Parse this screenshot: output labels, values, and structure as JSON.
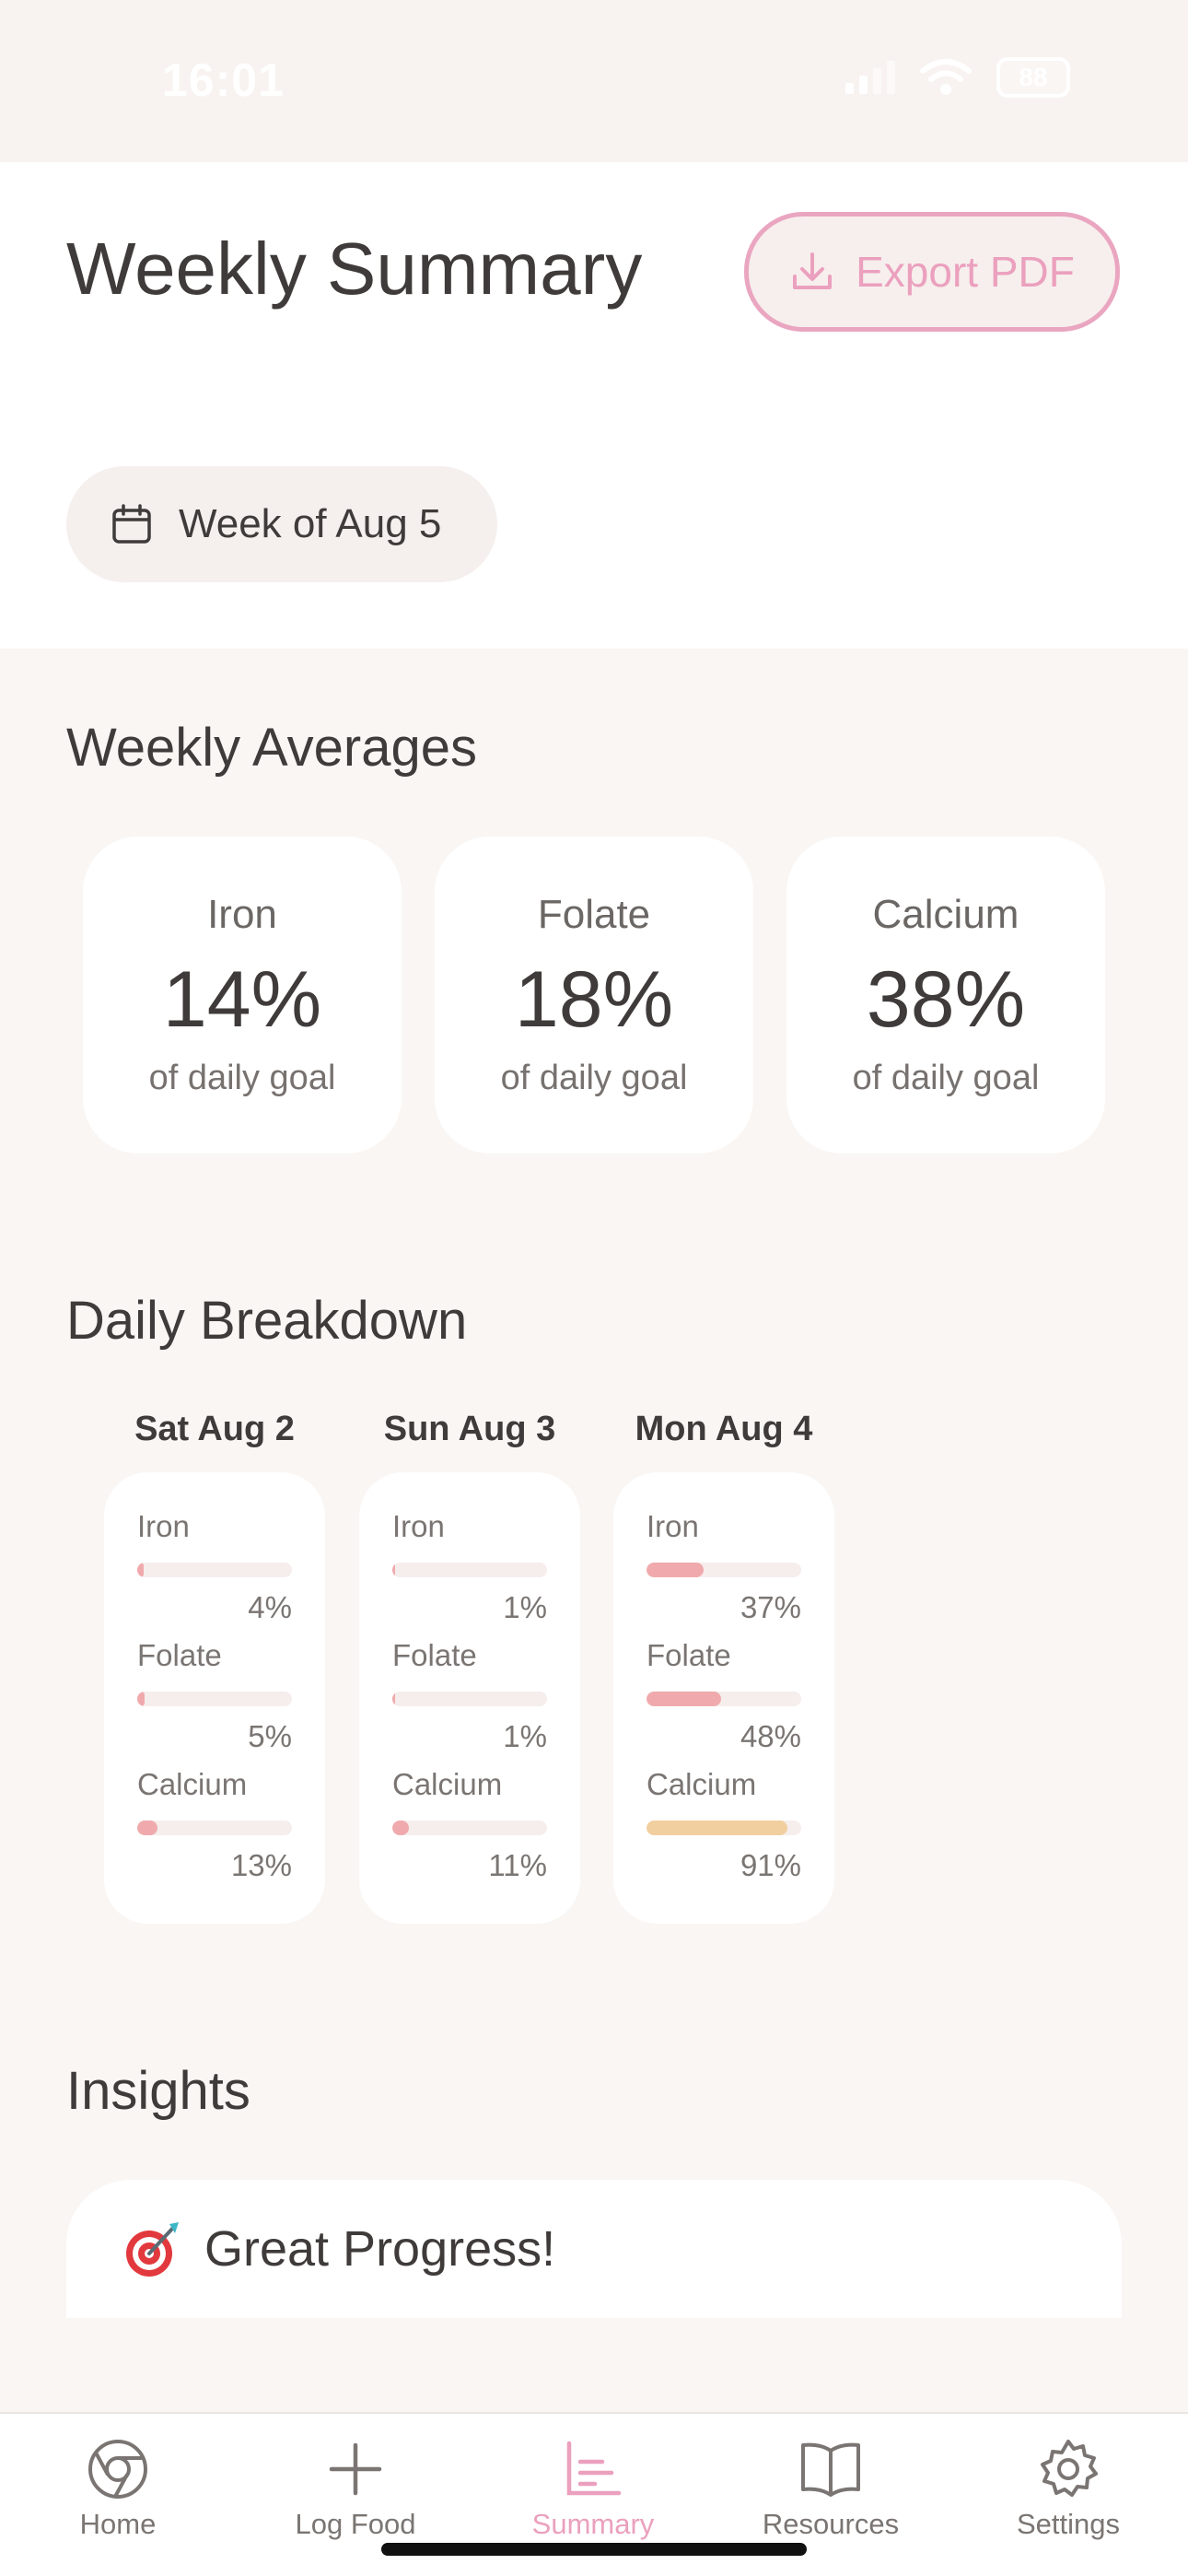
{
  "status_bar": {
    "time": "16:01",
    "battery": "88"
  },
  "header": {
    "title": "Weekly Summary",
    "export_label": "Export PDF",
    "week_label": "Week of Aug 5"
  },
  "averages": {
    "title": "Weekly Averages",
    "cards": [
      {
        "name": "Iron",
        "value": "14%",
        "sub": "of daily goal"
      },
      {
        "name": "Folate",
        "value": "18%",
        "sub": "of daily goal"
      },
      {
        "name": "Calcium",
        "value": "38%",
        "sub": "of daily goal"
      }
    ]
  },
  "daily": {
    "title": "Daily Breakdown",
    "days": [
      {
        "label": "Sat Aug 2",
        "nutrients": [
          {
            "name": "Iron",
            "pct": "4%",
            "fraction": 0.04
          },
          {
            "name": "Folate",
            "pct": "5%",
            "fraction": 0.05
          },
          {
            "name": "Calcium",
            "pct": "13%",
            "fraction": 0.13
          }
        ]
      },
      {
        "label": "Sun Aug 3",
        "nutrients": [
          {
            "name": "Iron",
            "pct": "1%",
            "fraction": 0.01
          },
          {
            "name": "Folate",
            "pct": "1%",
            "fraction": 0.01
          },
          {
            "name": "Calcium",
            "pct": "11%",
            "fraction": 0.11
          }
        ]
      },
      {
        "label": "Mon Aug 4",
        "nutrients": [
          {
            "name": "Iron",
            "pct": "37%",
            "fraction": 0.37
          },
          {
            "name": "Folate",
            "pct": "48%",
            "fraction": 0.48
          },
          {
            "name": "Calcium",
            "pct": "91%",
            "fraction": 0.91
          }
        ]
      }
    ]
  },
  "insights": {
    "title": "Insights",
    "card_title": "Great Progress!",
    "card_icon": "target-icon"
  },
  "tabs": [
    {
      "label": "Home",
      "icon": "home-icon"
    },
    {
      "label": "Log Food",
      "icon": "plus-icon"
    },
    {
      "label": "Summary",
      "icon": "chart-icon",
      "active": true
    },
    {
      "label": "Resources",
      "icon": "book-icon"
    },
    {
      "label": "Settings",
      "icon": "gear-icon"
    }
  ],
  "colors": {
    "accent": "#eba0be",
    "bar_low": "#f0aaad",
    "bar_high": "#f2cf9f",
    "background": "#faf6f3"
  }
}
